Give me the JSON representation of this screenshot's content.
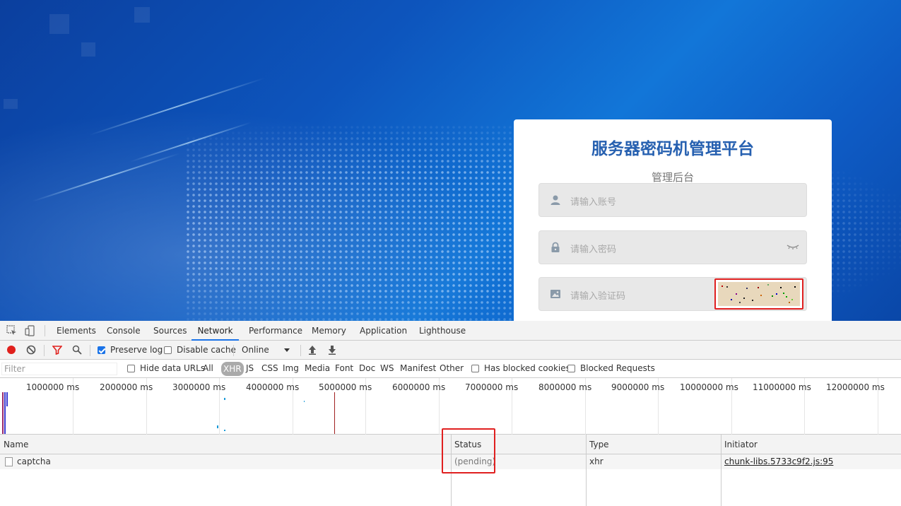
{
  "login": {
    "title": "服务器密码机管理平台",
    "subtitle": "管理后台",
    "username_placeholder": "请输入账号",
    "password_placeholder": "请输入密码",
    "captcha_placeholder": "请输入验证码"
  },
  "devtools": {
    "tabs": [
      "Elements",
      "Console",
      "Sources",
      "Network",
      "Performance",
      "Memory",
      "Application",
      "Lighthouse"
    ],
    "active_tab": "Network",
    "toolbar": {
      "preserve_log": "Preserve log",
      "preserve_log_checked": true,
      "disable_cache": "Disable cache",
      "disable_cache_checked": false,
      "throttling": "Online"
    },
    "filter": {
      "placeholder": "Filter",
      "hide_data_urls": "Hide data URLs",
      "types": [
        "All",
        "XHR",
        "JS",
        "CSS",
        "Img",
        "Media",
        "Font",
        "Doc",
        "WS",
        "Manifest",
        "Other"
      ],
      "active_type": "XHR",
      "has_blocked_cookies": "Has blocked cookies",
      "blocked_requests": "Blocked Requests"
    },
    "timeline_ticks": [
      "1000000 ms",
      "2000000 ms",
      "3000000 ms",
      "4000000 ms",
      "5000000 ms",
      "6000000 ms",
      "7000000 ms",
      "8000000 ms",
      "9000000 ms",
      "10000000 ms",
      "11000000 ms",
      "12000000 ms"
    ],
    "table": {
      "columns": [
        "Name",
        "Status",
        "Type",
        "Initiator"
      ],
      "rows": [
        {
          "name": "captcha",
          "status": "(pending)",
          "type": "xhr",
          "initiator": "chunk-libs.5733c9f2.js:95"
        }
      ]
    }
  }
}
